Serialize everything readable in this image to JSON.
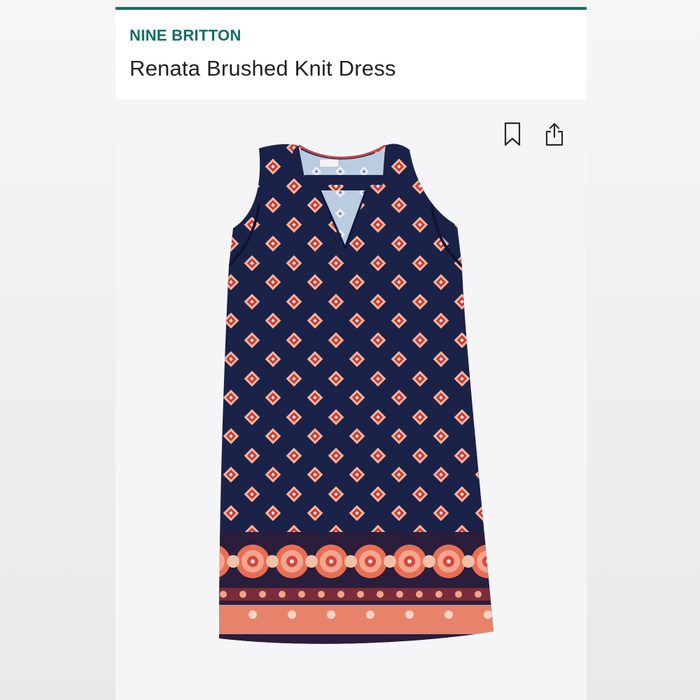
{
  "header": {
    "brand": "NINE BRITTON",
    "title": "Renata Brushed Knit Dress"
  },
  "actions": {
    "bookmark_icon": "bookmark-icon",
    "share_icon": "share-icon"
  },
  "colors": {
    "accent": "#0f6f63",
    "dress_navy": "#1b2247",
    "print_coral": "#e86e55",
    "print_cream": "#f6e3d6"
  }
}
